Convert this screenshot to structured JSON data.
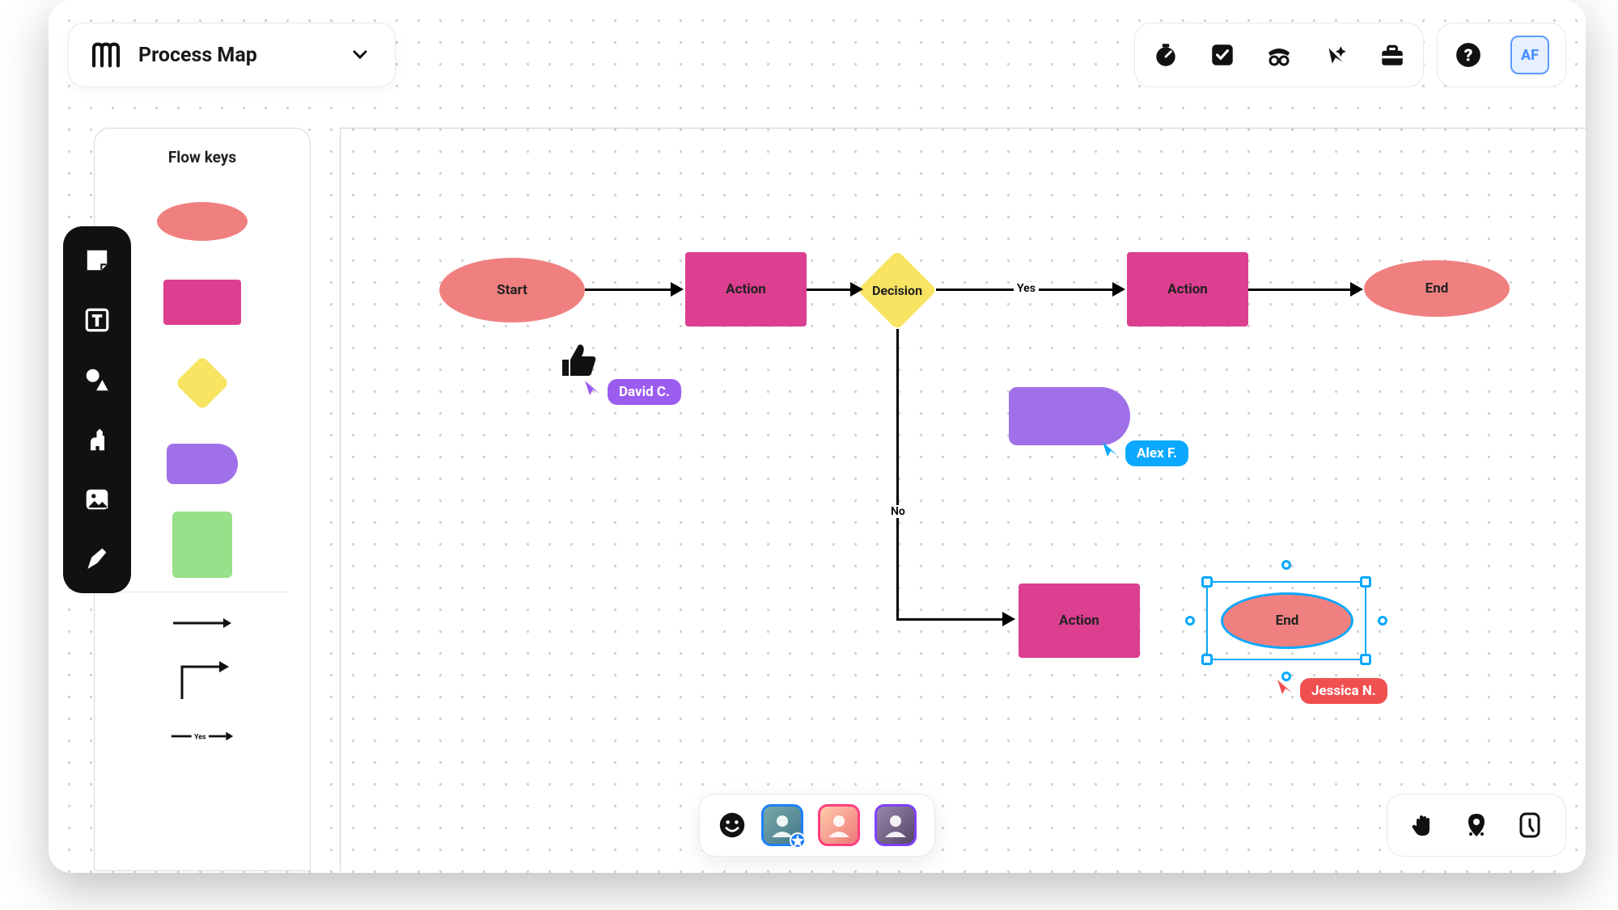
{
  "header": {
    "title": "Process Map",
    "avatar_initials": "AF",
    "tools": [
      "timer",
      "vote",
      "incognito",
      "cursor",
      "suitcase"
    ]
  },
  "sidebar": {
    "title": "Flow keys",
    "vertical_tools": [
      "note",
      "text",
      "shapes",
      "llama",
      "image",
      "pen"
    ]
  },
  "shapes": {
    "colors": {
      "terminal": "#f08080",
      "action": "#dc3f8f",
      "decision": "#f8e462",
      "tab": "#a070e8",
      "box": "#98e089"
    }
  },
  "nodes": {
    "start": "Start",
    "action1": "Action",
    "decision": "Decision",
    "action2": "Action",
    "end1": "End",
    "action3": "Action",
    "end2": "End"
  },
  "edges": {
    "yes": "Yes",
    "no": "No"
  },
  "cursors": {
    "david": {
      "name": "David C.",
      "color": "#9b5cf0"
    },
    "alex": {
      "name": "Alex F.",
      "color": "#0aa8ff"
    },
    "jessica": {
      "name": "Jessica N.",
      "color": "#f05050"
    }
  },
  "bottom_tools": [
    "hand",
    "map-pin",
    "tap"
  ]
}
